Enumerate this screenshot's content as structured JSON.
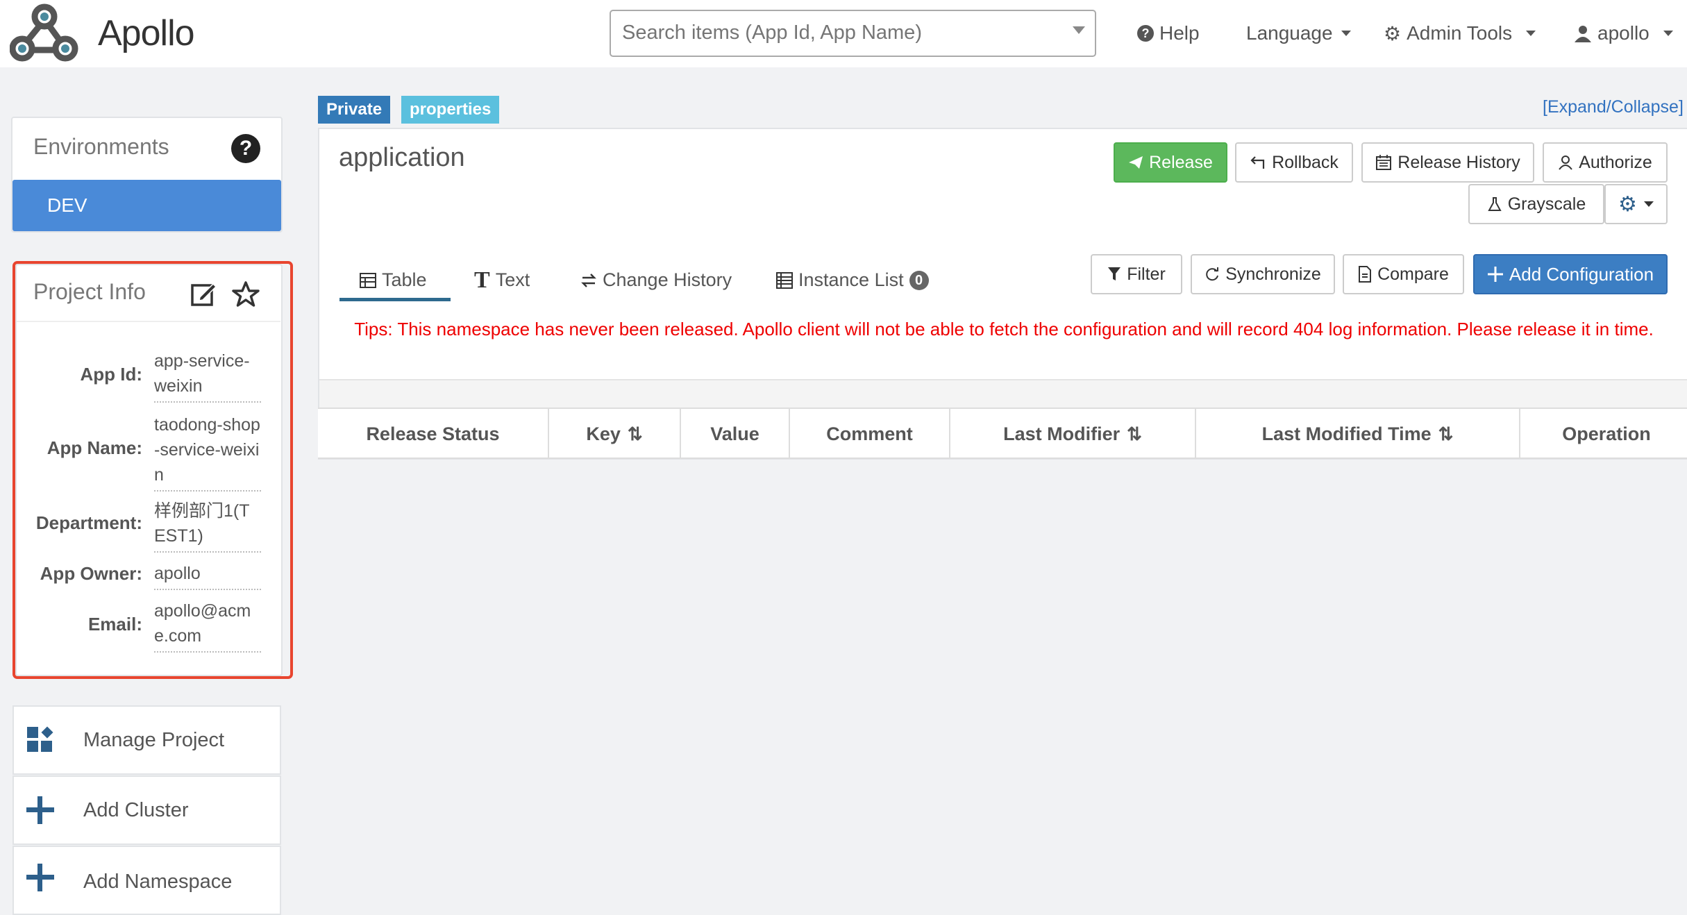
{
  "header": {
    "logo_text": "Apollo",
    "search_placeholder": "Search items (App Id, App Name)",
    "help": "Help",
    "language": "Language",
    "admin_tools": "Admin Tools",
    "user": "apollo"
  },
  "sidebar": {
    "environments_title": "Environments",
    "env_selected": "DEV",
    "project_info_title": "Project Info",
    "fields": {
      "app_id_label": "App Id:",
      "app_id": "app-service-weixin",
      "app_name_label": "App Name:",
      "app_name": "taodong-shop-service-weixin",
      "department_label": "Department:",
      "department": "样例部门1(TEST1)",
      "app_owner_label": "App Owner:",
      "app_owner": "apollo",
      "email_label": "Email:",
      "email": "apollo@acme.com"
    },
    "actions": {
      "manage_project": "Manage Project",
      "add_cluster": "Add Cluster",
      "add_namespace": "Add Namespace"
    }
  },
  "namespace": {
    "badge_private": "Private",
    "badge_format": "properties",
    "expand_collapse": "[Expand/Collapse]",
    "name": "application",
    "buttons": {
      "release": "Release",
      "rollback": "Rollback",
      "release_history": "Release History",
      "authorize": "Authorize",
      "grayscale": "Grayscale"
    },
    "tabs": {
      "table": "Table",
      "text": "Text",
      "change_history": "Change History",
      "instance_list": "Instance List",
      "instance_count": "0"
    },
    "toolbar": {
      "filter": "Filter",
      "synchronize": "Synchronize",
      "compare": "Compare",
      "add_configuration": "Add Configuration"
    },
    "tips": "Tips: This namespace has never been released. Apollo client will not be able to fetch the configuration and will record 404 log information. Please release it in time.",
    "columns": [
      "Release Status",
      "Key",
      "Value",
      "Comment",
      "Last Modifier",
      "Last Modified Time",
      "Operation"
    ]
  },
  "colors": {
    "accent_blue": "#4a8ad8",
    "release_green": "#5cb85c",
    "badge_private": "#337ab7",
    "badge_properties": "#5bc0de",
    "tips_red": "#e00000",
    "highlight_red": "#e8452f"
  }
}
